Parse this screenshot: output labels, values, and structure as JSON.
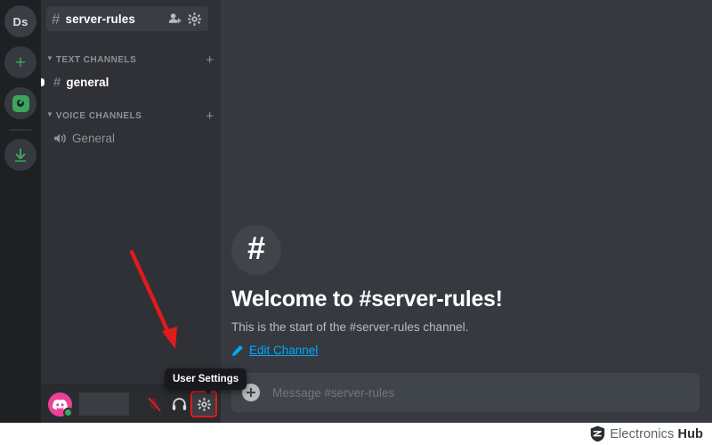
{
  "app": {
    "name": "Discord"
  },
  "rail": {
    "items": [
      {
        "name": "server-avatar",
        "label": "Ds",
        "icon": "server-avatar-icon"
      },
      {
        "name": "add-server",
        "label": "+",
        "icon": "plus-icon"
      },
      {
        "name": "explore-servers",
        "label": "",
        "icon": "compass-icon"
      },
      {
        "name": "download-apps",
        "label": "",
        "icon": "download-arrow-icon"
      }
    ]
  },
  "sidebar": {
    "header": {
      "hash": "#",
      "title": "server-rules",
      "invite_icon": "add-person-icon",
      "settings_icon": "gear-icon"
    },
    "categories": [
      {
        "label": "TEXT CHANNELS",
        "collapse_icon": "chevron-down-icon",
        "add_icon": "plus-icon",
        "channels": [
          {
            "hash": "#",
            "name": "general",
            "state": "active",
            "unread": true
          }
        ]
      },
      {
        "label": "VOICE CHANNELS",
        "collapse_icon": "chevron-down-icon",
        "add_icon": "plus-icon",
        "channels": [
          {
            "hash": "",
            "name": "General",
            "state": "idle",
            "unread": false
          }
        ]
      }
    ],
    "userbar": {
      "avatar_icon": "discord-avatar-icon",
      "status": "online",
      "username": "",
      "mic_label": "Mute",
      "mic_icon": "microphone-muted-icon",
      "headset_label": "Deafen",
      "headset_icon": "headphones-icon",
      "settings_label": "User Settings",
      "settings_icon": "gear-icon"
    },
    "tooltip": {
      "text": "User Settings"
    }
  },
  "main": {
    "welcome": {
      "hash_icon": "hash-icon",
      "title": "Welcome to #server-rules!",
      "subtitle": "This is the start of the #server-rules channel.",
      "edit_link": "Edit Channel",
      "edit_icon": "pencil-icon"
    },
    "composer": {
      "attach_icon": "plus-circle-icon",
      "placeholder": "Message #server-rules",
      "value": ""
    }
  },
  "annotation": {
    "arrow_color": "#e01b1b",
    "highlight_color": "#e01b1b",
    "points_to": "user-settings-gear"
  },
  "watermark": {
    "prefix": "Electronics ",
    "bold": "Hub",
    "icon": "shield-icon"
  },
  "colors": {
    "rail_bg": "#1e2124",
    "sidebar_bg": "#2f3136",
    "chat_bg": "#36393f",
    "userbar_bg": "#292b2f",
    "composer_bg": "#40444b",
    "accent_green": "#3ba55d",
    "link_blue": "#00a8fc",
    "avatar_pink": "#ed4197",
    "annotation_red": "#e01b1b"
  }
}
